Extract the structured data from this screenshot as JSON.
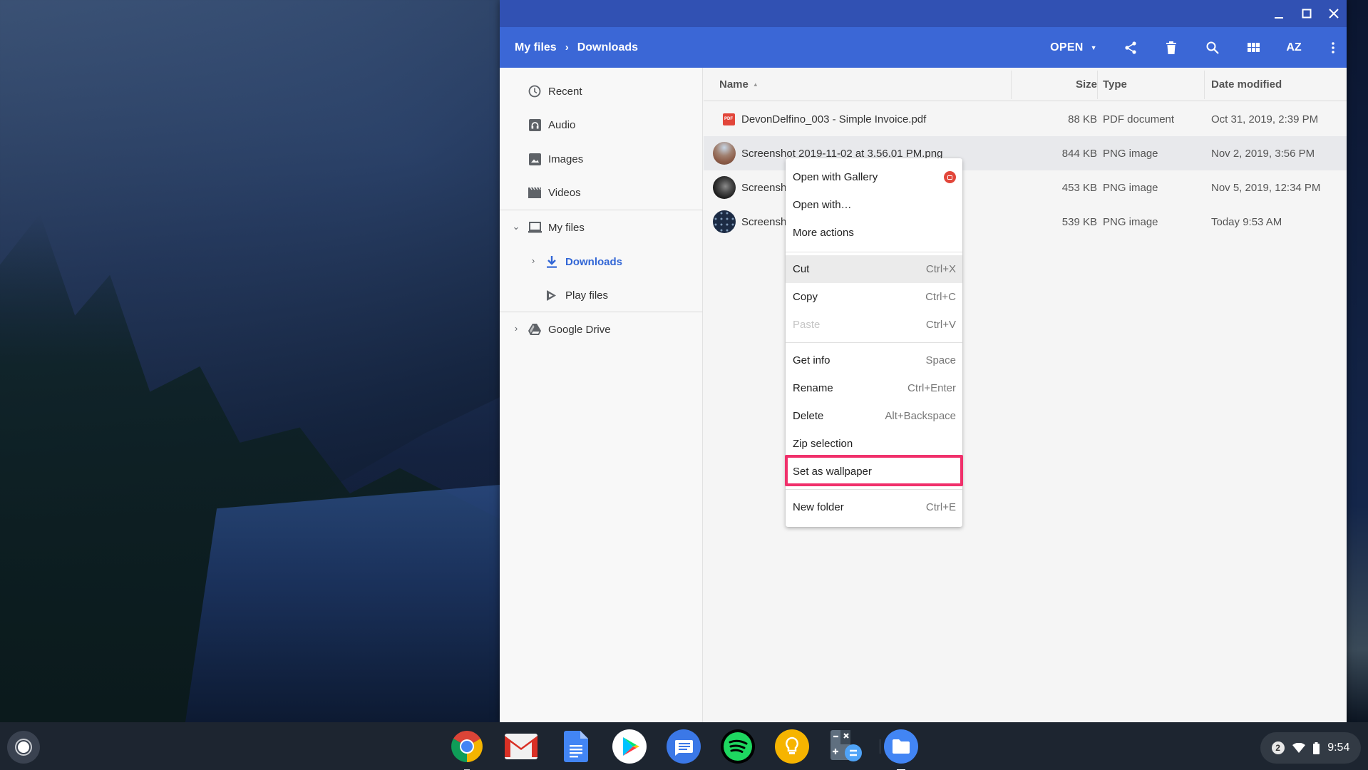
{
  "window": {
    "breadcrumb": [
      "My files",
      "Downloads"
    ],
    "breadcrumb_separator": "›",
    "controls": {
      "minimize": "minimize-icon",
      "maximize": "maximize-icon",
      "close": "close-icon"
    }
  },
  "toolbar": {
    "open_label": "OPEN",
    "icons": [
      "share-icon",
      "delete-icon",
      "search-icon",
      "grid-view-icon",
      "sort-icon",
      "more-vert-icon"
    ],
    "sort_label": "AZ"
  },
  "sidebar": {
    "items": [
      {
        "label": "Recent",
        "icon": "clock-icon"
      },
      {
        "label": "Audio",
        "icon": "audio-icon"
      },
      {
        "label": "Images",
        "icon": "image-icon"
      },
      {
        "label": "Videos",
        "icon": "video-icon"
      },
      {
        "label": "My files",
        "icon": "laptop-icon",
        "expanded": true
      },
      {
        "label": "Downloads",
        "icon": "download-icon",
        "active": true
      },
      {
        "label": "Play files",
        "icon": "play-icon",
        "expanded": false
      },
      {
        "label": "Google Drive",
        "icon": "drive-icon",
        "expanded": false
      }
    ]
  },
  "filelist": {
    "columns": {
      "name": "Name",
      "size": "Size",
      "type": "Type",
      "date": "Date modified"
    },
    "sort": {
      "column": "Name",
      "direction": "ascending"
    },
    "rows": [
      {
        "name": "DevonDelfino_003 - Simple Invoice.pdf",
        "size": "88 KB",
        "type": "PDF document",
        "date": "Oct 31, 2019, 2:39 PM",
        "icon": "pdf-icon",
        "selected": false
      },
      {
        "name": "Screenshot 2019-11-02 at 3.56.01 PM.png",
        "size": "844 KB",
        "type": "PNG image",
        "date": "Nov 2, 2019, 3:56 PM",
        "icon": "image-thumbnail",
        "selected": true
      },
      {
        "name": "Screenshot",
        "size": "453 KB",
        "type": "PNG image",
        "date": "Nov 5, 2019, 12:34 PM",
        "icon": "image-thumbnail",
        "selected": false
      },
      {
        "name": "Screenshot",
        "size": "539 KB",
        "type": "PNG image",
        "date": "Today 9:53 AM",
        "icon": "image-thumbnail",
        "selected": false
      }
    ]
  },
  "context_menu": {
    "items": [
      {
        "label": "Open with Gallery",
        "shortcut": "",
        "icon": "gallery-icon"
      },
      {
        "label": "Open with…",
        "shortcut": ""
      },
      {
        "label": "More actions",
        "shortcut": ""
      },
      {
        "label": "Cut",
        "shortcut": "Ctrl+X",
        "hovered": true
      },
      {
        "label": "Copy",
        "shortcut": "Ctrl+C"
      },
      {
        "label": "Paste",
        "shortcut": "Ctrl+V",
        "disabled": true
      },
      {
        "label": "Get info",
        "shortcut": "Space"
      },
      {
        "label": "Rename",
        "shortcut": "Ctrl+Enter"
      },
      {
        "label": "Delete",
        "shortcut": "Alt+Backspace"
      },
      {
        "label": "Zip selection",
        "shortcut": ""
      },
      {
        "label": "Set as wallpaper",
        "shortcut": "",
        "highlighted": true
      },
      {
        "label": "New folder",
        "shortcut": "Ctrl+E"
      }
    ],
    "highlight_color": "#f0306b"
  },
  "shelf": {
    "apps": [
      "Chrome",
      "Gmail",
      "Docs",
      "Play Store",
      "Messages",
      "Spotify",
      "Keep",
      "Calculator",
      "Files"
    ],
    "tray": {
      "notifications": "2",
      "time": "9:54"
    }
  },
  "colors": {
    "titlebar": "#3151b3",
    "toolbar": "#3b67d6",
    "accent": "#3367d6"
  }
}
